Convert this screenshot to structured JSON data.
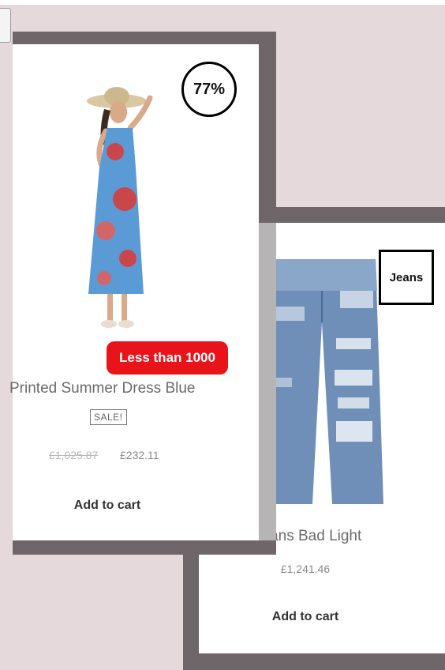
{
  "products": [
    {
      "name": "Printed Summer Dress Blue",
      "discount_badge": "77%",
      "promo_label": "Less than 1000",
      "sale_tag": "SALE!",
      "old_price": "£1,025.87",
      "price": "£232.11",
      "cart_label": "Add to cart",
      "image": "summer-dress-photo"
    },
    {
      "name": "Jeans Bad Light",
      "category_badge": "Jeans",
      "price": "£1,241.46",
      "cart_label": "Add to cart",
      "image": "ripped-jeans-photo"
    }
  ],
  "colors": {
    "background": "#e6d9dc",
    "card_frame": "#6e6669",
    "promo_red": "#e8141a"
  }
}
